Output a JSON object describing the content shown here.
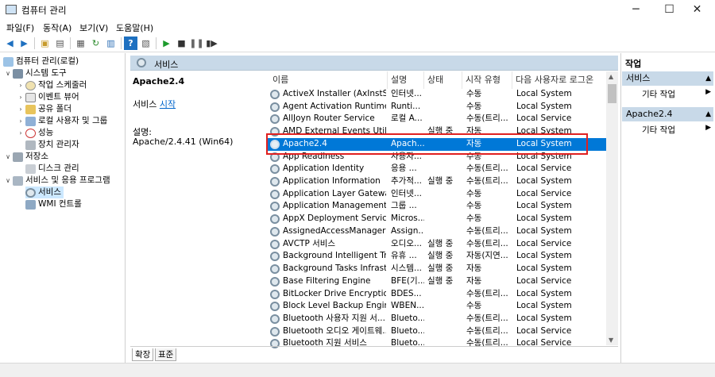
{
  "window": {
    "title": "컴퓨터 관리",
    "minimize": "─",
    "maximize": "☐",
    "close": "✕"
  },
  "menu": [
    "파일(F)",
    "동작(A)",
    "보기(V)",
    "도움말(H)"
  ],
  "tree": {
    "root": "컴퓨터 관리(로컬)",
    "system_tools": "시스템 도구",
    "task_scheduler": "작업 스케줄러",
    "event_viewer": "이벤트 뷰어",
    "shared_folders": "공유 폴더",
    "local_users": "로컬 사용자 및 그룹",
    "performance": "성능",
    "device_manager": "장치 관리자",
    "storage": "저장소",
    "disk_management": "디스크 관리",
    "services_apps": "서비스 및 응용 프로그램",
    "services": "서비스",
    "wmi": "WMI 컨트롤"
  },
  "center": {
    "header": "서비스",
    "selected_title": "Apache2.4",
    "start_prefix": "서비스 ",
    "start_link": "시작",
    "desc_label": "설명:",
    "desc_value": "Apache/2.4.41 (Win64)"
  },
  "columns": [
    "이름",
    "설명",
    "상태",
    "시작 유형",
    "다음 사용자로 로그온"
  ],
  "rows": [
    {
      "name": "ActiveX Installer (AxInstSV)",
      "desc": "인터넷...",
      "status": "",
      "startup": "수동",
      "logon": "Local System"
    },
    {
      "name": "Agent Activation Runtime_...",
      "desc": "Runti...",
      "status": "",
      "startup": "수동",
      "logon": "Local System"
    },
    {
      "name": "AllJoyn Router Service",
      "desc": "로컬 A...",
      "status": "",
      "startup": "수동(트리...",
      "logon": "Local Service"
    },
    {
      "name": "AMD External Events Utility",
      "desc": "",
      "status": "실행 중",
      "startup": "자동",
      "logon": "Local System"
    },
    {
      "name": "Apache2.4",
      "desc": "Apach...",
      "status": "",
      "startup": "자동",
      "logon": "Local System"
    },
    {
      "name": "App Readiness",
      "desc": "사용자...",
      "status": "",
      "startup": "수동",
      "logon": "Local System"
    },
    {
      "name": "Application Identity",
      "desc": "응용 ...",
      "status": "",
      "startup": "수동(트리...",
      "logon": "Local Service"
    },
    {
      "name": "Application Information",
      "desc": "추가적...",
      "status": "실행 중",
      "startup": "수동(트리...",
      "logon": "Local System"
    },
    {
      "name": "Application Layer Gateway ...",
      "desc": "인터넷...",
      "status": "",
      "startup": "수동",
      "logon": "Local Service"
    },
    {
      "name": "Application Management",
      "desc": "그룹 ...",
      "status": "",
      "startup": "수동",
      "logon": "Local System"
    },
    {
      "name": "AppX Deployment Service ...",
      "desc": "Micros...",
      "status": "",
      "startup": "수동",
      "logon": "Local System"
    },
    {
      "name": "AssignedAccessManager 서...",
      "desc": "Assign...",
      "status": "",
      "startup": "수동(트리...",
      "logon": "Local System"
    },
    {
      "name": "AVCTP 서비스",
      "desc": "오디오...",
      "status": "실행 중",
      "startup": "수동(트리...",
      "logon": "Local Service"
    },
    {
      "name": "Background Intelligent Tra...",
      "desc": "유휴 ...",
      "status": "실행 중",
      "startup": "자동(지연...",
      "logon": "Local System"
    },
    {
      "name": "Background Tasks Infrastru...",
      "desc": "시스템...",
      "status": "실행 중",
      "startup": "자동",
      "logon": "Local System"
    },
    {
      "name": "Base Filtering Engine",
      "desc": "BFE(기...",
      "status": "실행 중",
      "startup": "자동",
      "logon": "Local Service"
    },
    {
      "name": "BitLocker Drive Encryption ...",
      "desc": "BDES...",
      "status": "",
      "startup": "수동(트리...",
      "logon": "Local System"
    },
    {
      "name": "Block Level Backup Engine ...",
      "desc": "WBEN...",
      "status": "",
      "startup": "수동",
      "logon": "Local System"
    },
    {
      "name": "Bluetooth 사용자 지원 서...",
      "desc": "Blueto...",
      "status": "",
      "startup": "수동(트리...",
      "logon": "Local System"
    },
    {
      "name": "Bluetooth 오디오 게이트웨...",
      "desc": "Blueto...",
      "status": "",
      "startup": "수동(트리...",
      "logon": "Local Service"
    },
    {
      "name": "Bluetooth 지원 서비스",
      "desc": "Blueto...",
      "status": "",
      "startup": "수동(트리...",
      "logon": "Local Service"
    }
  ],
  "tabs": [
    "확장",
    "표준"
  ],
  "actions": {
    "title": "작업",
    "group1": "서비스",
    "group1_item": "기타 작업",
    "group2": "Apache2.4",
    "group2_item": "기타 작업"
  }
}
